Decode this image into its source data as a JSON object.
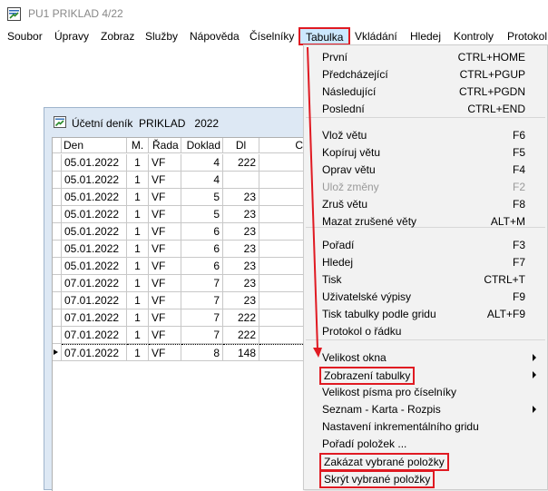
{
  "window": {
    "title": "PU1 PRIKLAD 4/22"
  },
  "menubar": [
    "Soubor",
    "Úpravy",
    "Zobraz",
    "Služby",
    "Nápověda",
    "Číselníky",
    "Tabulka",
    "Vkládání",
    "Hledej",
    "Kontroly",
    "Protokol"
  ],
  "child_window": {
    "title": "Účetní deník  PRIKLAD   2022",
    "columns": [
      "Den",
      "M.",
      "Řada",
      "Doklad",
      "Dl",
      "C"
    ],
    "rows": [
      [
        "05.01.2022",
        "1",
        "VF",
        "4",
        "222"
      ],
      [
        "05.01.2022",
        "1",
        "VF",
        "4",
        ""
      ],
      [
        "05.01.2022",
        "1",
        "VF",
        "5",
        "23"
      ],
      [
        "05.01.2022",
        "1",
        "VF",
        "5",
        "23"
      ],
      [
        "05.01.2022",
        "1",
        "VF",
        "6",
        "23"
      ],
      [
        "05.01.2022",
        "1",
        "VF",
        "6",
        "23"
      ],
      [
        "05.01.2022",
        "1",
        "VF",
        "6",
        "23"
      ],
      [
        "07.01.2022",
        "1",
        "VF",
        "7",
        "23"
      ],
      [
        "07.01.2022",
        "1",
        "VF",
        "7",
        "23"
      ],
      [
        "07.01.2022",
        "1",
        "VF",
        "7",
        "222"
      ],
      [
        "07.01.2022",
        "1",
        "VF",
        "7",
        "222"
      ],
      [
        "07.01.2022",
        "1",
        "VF",
        "8",
        "148"
      ]
    ]
  },
  "tabulka_menu": {
    "group1": [
      {
        "label": "První",
        "shortcut": "CTRL+HOME"
      },
      {
        "label": "Předcházející",
        "shortcut": "CTRL+PGUP"
      },
      {
        "label": "Následující",
        "shortcut": "CTRL+PGDN"
      },
      {
        "label": "Poslední",
        "shortcut": "CTRL+END"
      }
    ],
    "group2": [
      {
        "label": "Vlož větu",
        "shortcut": "F6"
      },
      {
        "label": "Kopíruj větu",
        "shortcut": "F5"
      },
      {
        "label": "Oprav větu",
        "shortcut": "F4"
      },
      {
        "label": "Ulož změny",
        "shortcut": "F2",
        "disabled": true
      },
      {
        "label": "Zruš větu",
        "shortcut": "F8"
      },
      {
        "label": "Mazat zrušené věty",
        "shortcut": "ALT+M"
      }
    ],
    "group3": [
      {
        "label": "Pořadí",
        "shortcut": "F3"
      },
      {
        "label": "Hledej",
        "shortcut": "F7"
      },
      {
        "label": "Tisk",
        "shortcut": "CTRL+T"
      },
      {
        "label": "Uživatelské výpisy",
        "shortcut": "F9"
      },
      {
        "label": "Tisk tabulky podle gridu",
        "shortcut": "ALT+F9"
      },
      {
        "label": "Protokol o řádku",
        "shortcut": ""
      }
    ],
    "group4": [
      {
        "label": "Velikost okna",
        "submenu": true
      },
      {
        "label": "Zobrazení tabulky",
        "submenu": true,
        "highlighted": true
      },
      {
        "label": "Velikost písma pro číselníky"
      },
      {
        "label": "Seznam - Karta - Rozpis",
        "submenu": true
      },
      {
        "label": "Nastavení inkrementálního gridu"
      },
      {
        "label": "Pořadí položek ..."
      },
      {
        "label": "Zakázat vybrané položky",
        "highlighted": true
      },
      {
        "label": "Skrýt vybrané položky",
        "highlighted": true
      }
    ]
  },
  "colors": {
    "highlight_border": "#e01a22",
    "active_menu_bg": "#cce8ff",
    "menu_bg": "#f2f2f2",
    "child_bg": "#dde8f4"
  }
}
